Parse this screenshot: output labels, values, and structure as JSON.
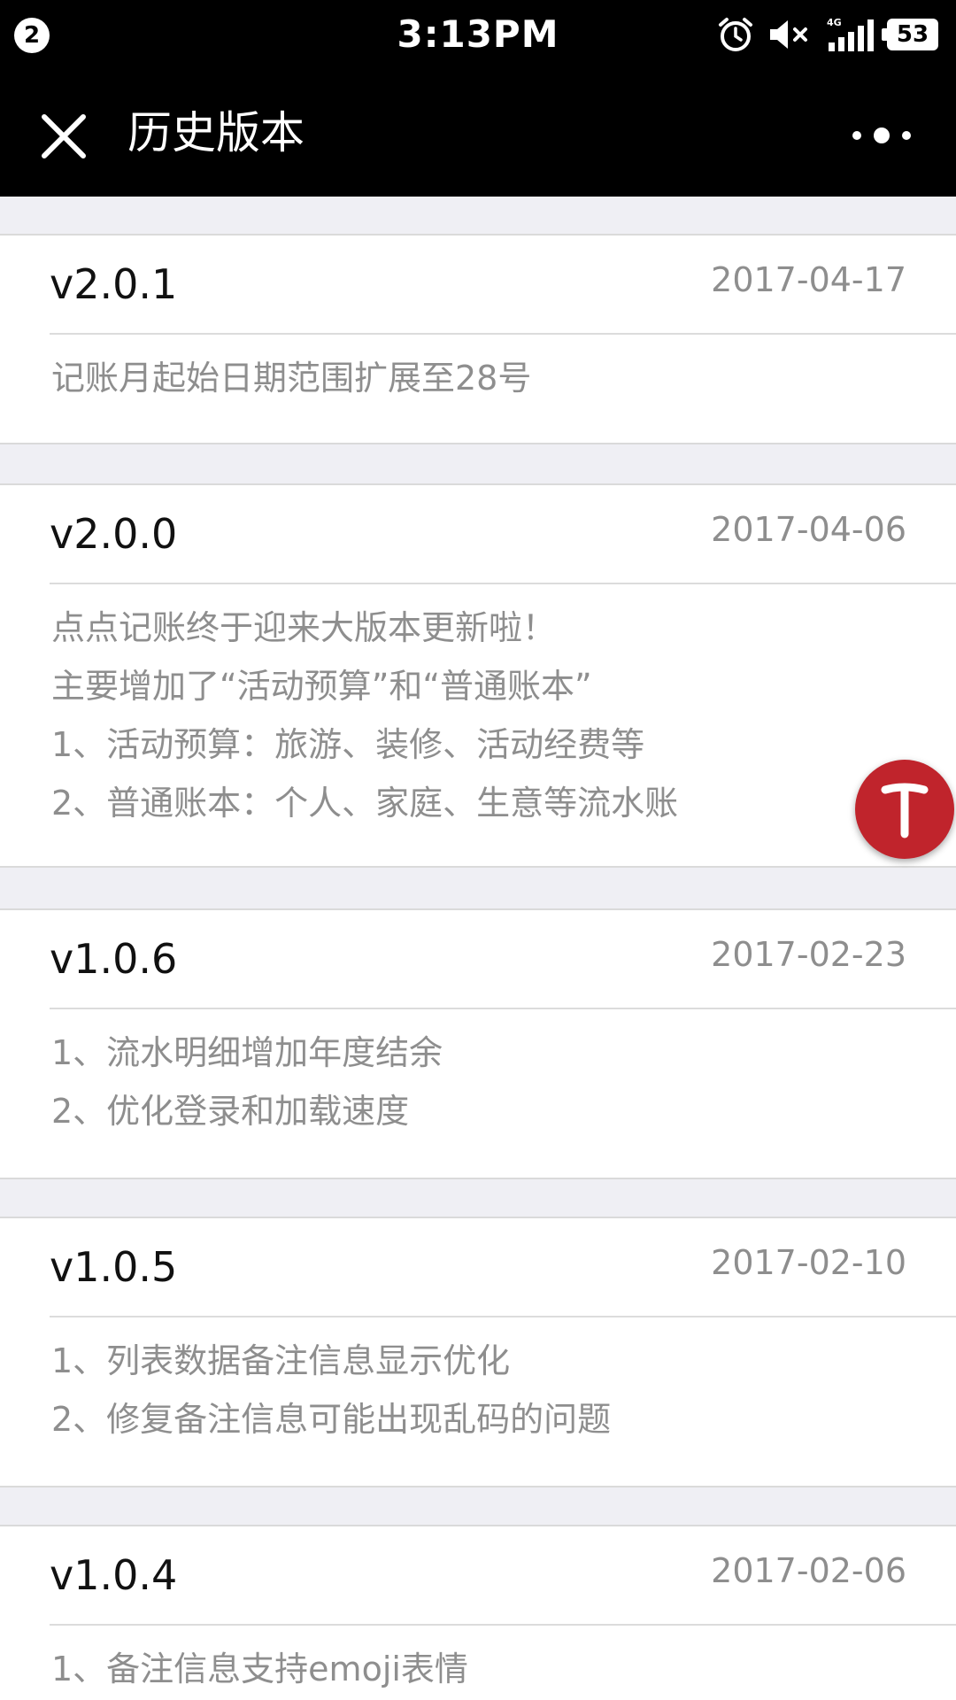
{
  "status_bar": {
    "notification_count": "2",
    "time": "3:13PM",
    "network": "4G",
    "battery": "53",
    "icons": [
      "alarm-icon",
      "mute-icon",
      "signal-icon",
      "battery-icon"
    ]
  },
  "nav": {
    "title": "历史版本",
    "close_icon": "close-icon",
    "more_icon": "more-icon"
  },
  "versions": [
    {
      "version": "v2.0.1",
      "date": "2017-04-17",
      "notes": [
        "记账月起始日期范围扩展至28号"
      ]
    },
    {
      "version": "v2.0.0",
      "date": "2017-04-06",
      "notes": [
        "点点记账终于迎来大版本更新啦！",
        "主要增加了“活动预算”和“普通账本”",
        "1、活动预算：旅游、装修、活动经费等",
        "2、普通账本：个人、家庭、生意等流水账"
      ]
    },
    {
      "version": "v1.0.6",
      "date": "2017-02-23",
      "notes": [
        "1、流水明细增加年度结余",
        "2、优化登录和加载速度"
      ]
    },
    {
      "version": "v1.0.5",
      "date": "2017-02-10",
      "notes": [
        "1、列表数据备注信息显示优化",
        "2、修复备注信息可能出现乱码的问题"
      ]
    },
    {
      "version": "v1.0.4",
      "date": "2017-02-06",
      "notes": [
        "1、备注信息支持emoji表情"
      ]
    }
  ],
  "floating_button": {
    "icon": "t-icon",
    "color": "#c0242c"
  }
}
